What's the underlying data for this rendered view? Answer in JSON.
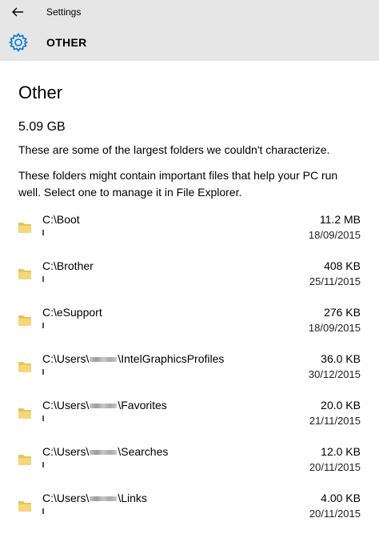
{
  "window": {
    "title": "Settings"
  },
  "header": {
    "title": "OTHER"
  },
  "page": {
    "title": "Other",
    "total": "5.09 GB",
    "description_1": "These are some of the largest folders we couldn't characterize.",
    "description_2": "These folders might contain important files that help your PC run well. Select one to manage it in File Explorer."
  },
  "folders": [
    {
      "prefix": "C:\\Boot",
      "suffix": "",
      "redacted": false,
      "size": "11.2 MB",
      "date": "18/09/2015"
    },
    {
      "prefix": "C:\\Brother",
      "suffix": "",
      "redacted": false,
      "size": "408 KB",
      "date": "25/11/2015"
    },
    {
      "prefix": "C:\\eSupport",
      "suffix": "",
      "redacted": false,
      "size": "276 KB",
      "date": "18/09/2015"
    },
    {
      "prefix": "C:\\Users\\",
      "suffix": "\\IntelGraphicsProfiles",
      "redacted": true,
      "size": "36.0 KB",
      "date": "30/12/2015"
    },
    {
      "prefix": "C:\\Users\\",
      "suffix": "\\Favorites",
      "redacted": true,
      "size": "20.0 KB",
      "date": "21/11/2015"
    },
    {
      "prefix": "C:\\Users\\",
      "suffix": "\\Searches",
      "redacted": true,
      "size": "12.0 KB",
      "date": "20/11/2015"
    },
    {
      "prefix": "C:\\Users\\",
      "suffix": "\\Links",
      "redacted": true,
      "size": "4.00 KB",
      "date": "20/11/2015"
    }
  ],
  "colors": {
    "accent": "#0078d7",
    "header_bg": "#e6e6e6",
    "folder": "#e8c25a"
  },
  "icons": {
    "back": "back-arrow-icon",
    "settings": "gear-icon",
    "folder": "folder-icon"
  }
}
